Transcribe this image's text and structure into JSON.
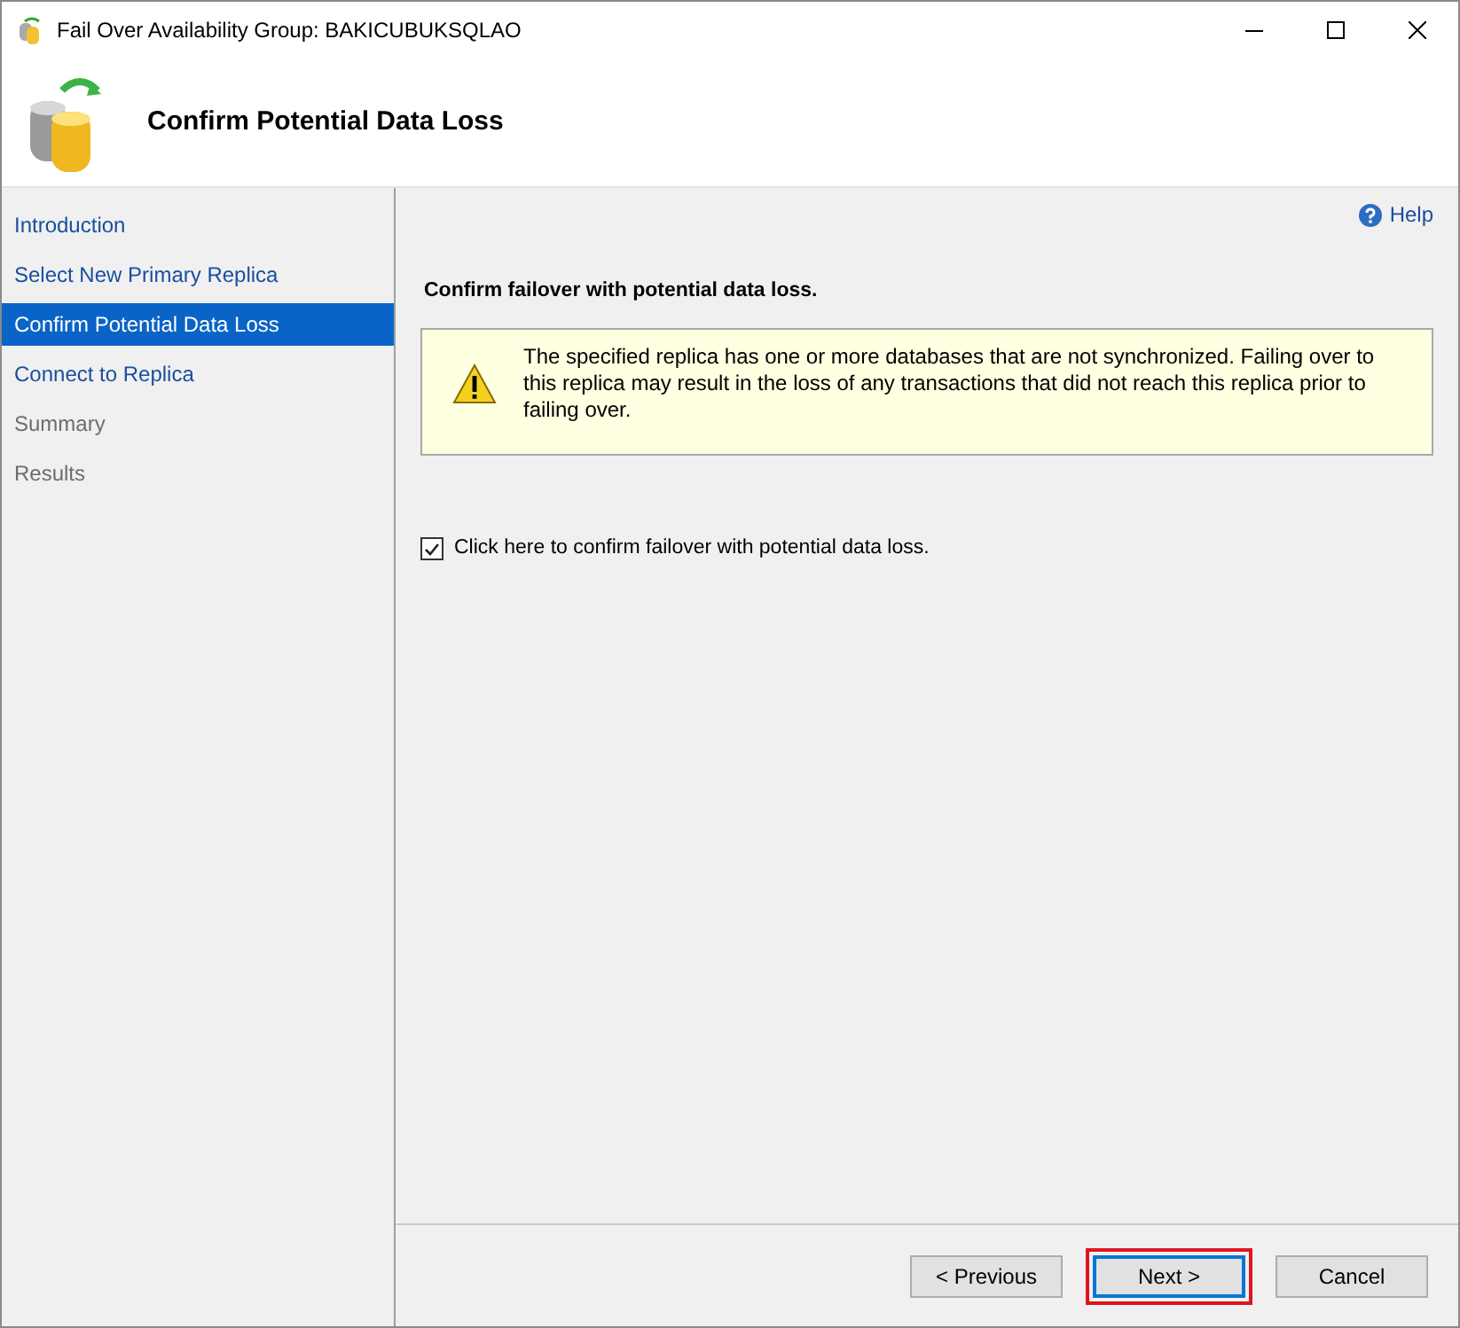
{
  "window": {
    "title": "Fail Over Availability Group: BAKICUBUKSQLAO"
  },
  "header": {
    "title": "Confirm Potential Data Loss"
  },
  "sidebar": {
    "items": [
      {
        "label": "Introduction",
        "selected": false,
        "disabled": false
      },
      {
        "label": "Select New Primary Replica",
        "selected": false,
        "disabled": false
      },
      {
        "label": "Confirm Potential Data Loss",
        "selected": true,
        "disabled": false
      },
      {
        "label": "Connect to Replica",
        "selected": false,
        "disabled": false
      },
      {
        "label": "Summary",
        "selected": false,
        "disabled": true
      },
      {
        "label": "Results",
        "selected": false,
        "disabled": true
      }
    ]
  },
  "help": {
    "label": "Help"
  },
  "content": {
    "heading": "Confirm failover with potential data loss.",
    "warning": "The specified replica has one or more databases that are not synchronized. Failing over to this replica may result in the loss of any transactions that did not reach this replica prior to failing over.",
    "confirm": {
      "label": "Click here to confirm failover with potential data loss.",
      "checked": true
    }
  },
  "buttons": [
    {
      "label": "< Previous",
      "focused": false,
      "highlighted": false
    },
    {
      "label": "Next >",
      "focused": true,
      "highlighted": true
    },
    {
      "label": "Cancel",
      "focused": false,
      "highlighted": false
    }
  ]
}
